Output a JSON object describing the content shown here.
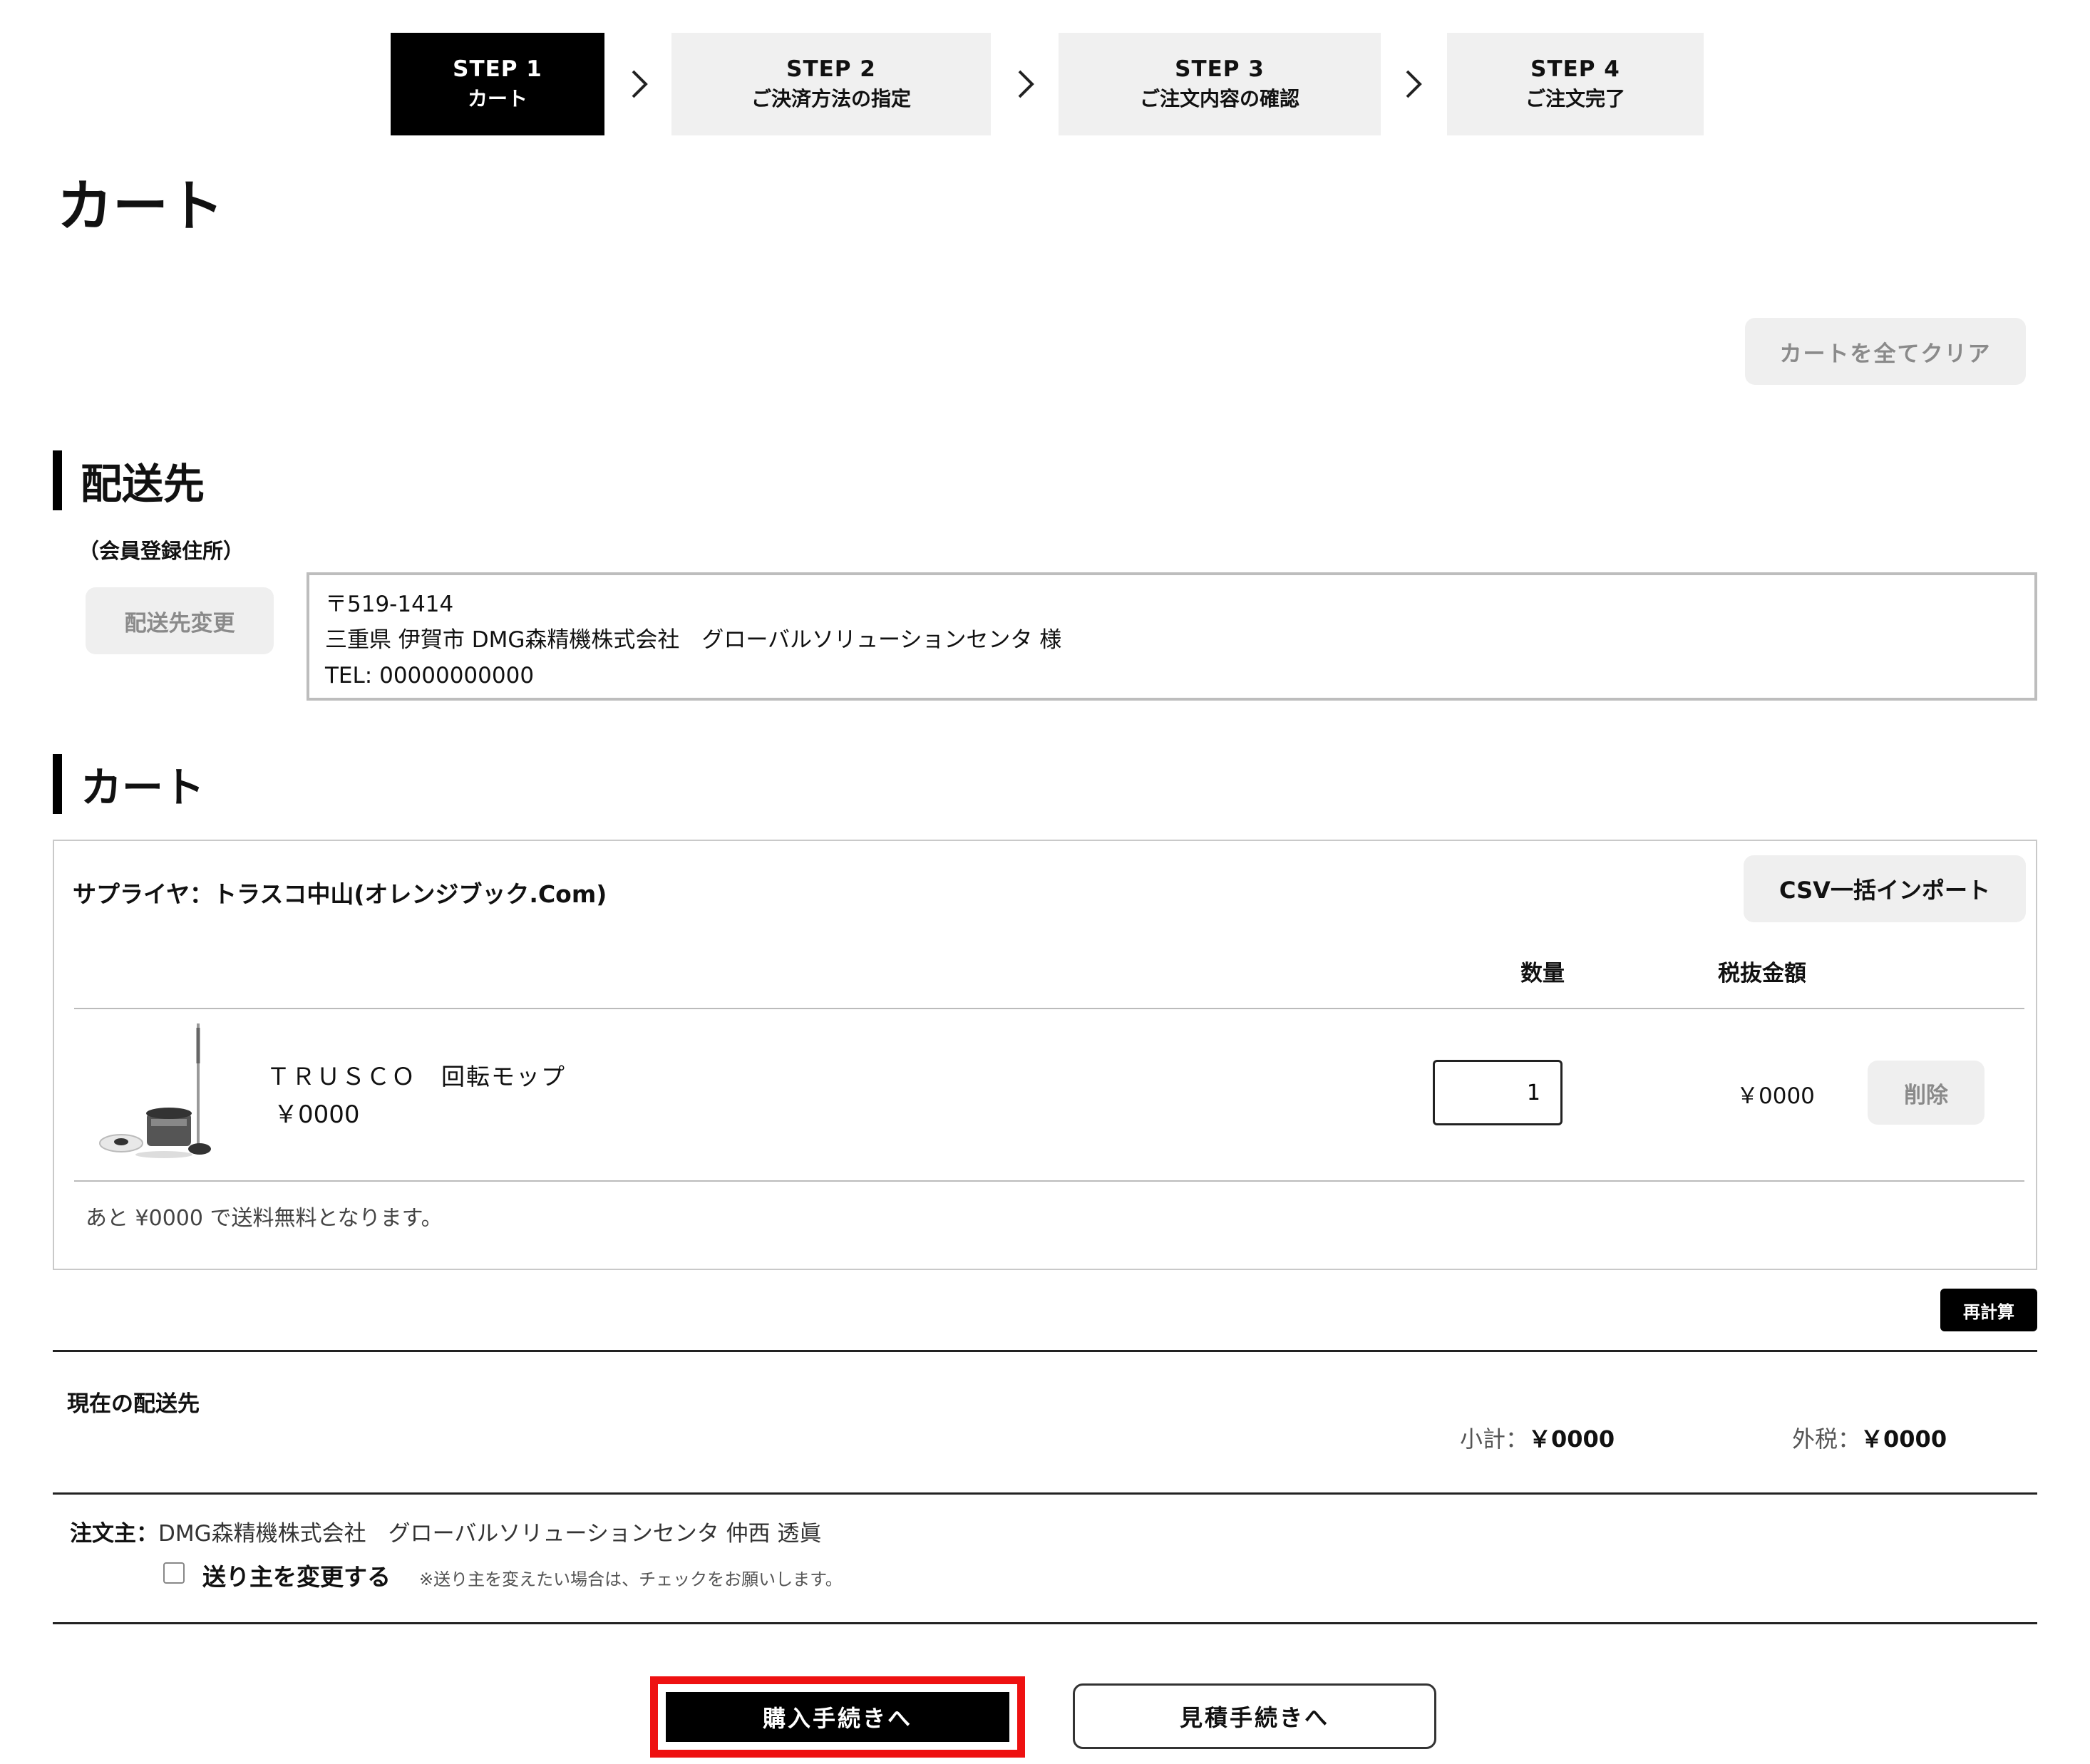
{
  "steps": [
    {
      "label": "STEP 1",
      "sub": "カート"
    },
    {
      "label": "STEP 2",
      "sub": "ご決済方法の指定"
    },
    {
      "label": "STEP 3",
      "sub": "ご注文内容の確認"
    },
    {
      "label": "STEP 4",
      "sub": "ご注文完了"
    }
  ],
  "page_title": "カート",
  "clear_cart_label": "カートを全てクリア",
  "shipping": {
    "section_title": "配送先",
    "sub_label": "（会員登録住所）",
    "change_label": "配送先変更",
    "address_lines": [
      "〒519-1414",
      "三重県 伊賀市 DMG森精機株式会社　グローバルソリューションセンタ 様",
      "TEL: 00000000000"
    ]
  },
  "cart": {
    "section_title": "カート",
    "supplier": "サプライヤ：トラスコ中山(オレンジブック.Com)",
    "csv_import_label": "CSV一括インポート",
    "col_qty": "数量",
    "col_price": "税抜金額",
    "item": {
      "name": "ＴＲＵＳＣＯ　回転モップ",
      "unit_price": "￥0000",
      "quantity": "1",
      "line_total": "￥0000",
      "delete_label": "削除"
    },
    "free_shipping_note": "あと ¥0000 で送料無料となります。"
  },
  "recalc_label": "再計算",
  "summary": {
    "current_shipping_label": "現在の配送先",
    "subtotal_label": "小計：",
    "subtotal_value": "￥0000",
    "tax_label": "外税：",
    "tax_value": "￥0000"
  },
  "orderer": {
    "label": "注文主：",
    "name": "DMG森精機株式会社　グローバルソリューションセンタ 仲西 透眞",
    "change_sender_label": "送り主を変更する",
    "change_sender_note": "※送り主を変えたい場合は、チェックをお願いします。"
  },
  "buttons": {
    "purchase": "購入手続きへ",
    "quote": "見積手続きへ"
  }
}
